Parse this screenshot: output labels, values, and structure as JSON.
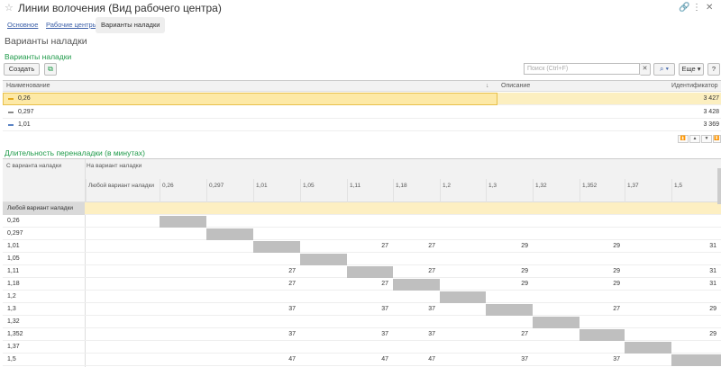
{
  "window": {
    "title": "Линии волочения (Вид рабочего центра)"
  },
  "tabs": [
    {
      "label": "Основное",
      "active": false
    },
    {
      "label": "Рабочие центры",
      "active": false
    },
    {
      "label": "Варианты наладки",
      "active": true
    }
  ],
  "subtitle": "Варианты наладки",
  "variants": {
    "section_title": "Варианты наладки",
    "create_label": "Создать",
    "search_placeholder": "Поиск (Ctrl+F)",
    "more_label": "Еще",
    "help_label": "?",
    "columns": {
      "name": "Наименование",
      "description": "Описание",
      "id": "Идентификатор"
    },
    "rows": [
      {
        "name": "0,26",
        "description": "",
        "id": "3 427",
        "selected": true,
        "marker_color": "#e3a91b"
      },
      {
        "name": "0,297",
        "description": "",
        "id": "3 428",
        "selected": false,
        "marker_color": "#8a8a8a"
      },
      {
        "name": "1,01",
        "description": "",
        "id": "3 369",
        "selected": false,
        "marker_color": "#5b83c4"
      }
    ]
  },
  "duration": {
    "section_title": "Длительность переналадки (в минутах)",
    "from_header": "С варианта наладки",
    "to_header": "На вариант наладки",
    "any_label": "Любой вариант наладки",
    "columns": [
      "Любой вариант наладки",
      "0,26",
      "0,297",
      "1,01",
      "1,05",
      "1,11",
      "1,18",
      "1,2",
      "1,3",
      "1,32",
      "1,352",
      "1,37",
      "1,5"
    ],
    "rows": [
      {
        "label": "Любой вариант наладки",
        "values": [
          "",
          "",
          "",
          "",
          "",
          "",
          "",
          "",
          "",
          "",
          "",
          ""
        ]
      },
      {
        "label": "0,26",
        "values": [
          "",
          "",
          "",
          "",
          "",
          "",
          "",
          "",
          "",
          "",
          "",
          ""
        ]
      },
      {
        "label": "0,297",
        "values": [
          "",
          "",
          "",
          "",
          "",
          "",
          "",
          "",
          "",
          "",
          "",
          ""
        ]
      },
      {
        "label": "1,01",
        "values": [
          "",
          "",
          "",
          "",
          "27",
          "27",
          "",
          "29",
          "",
          "29",
          "",
          "31"
        ]
      },
      {
        "label": "1,05",
        "values": [
          "",
          "",
          "",
          "",
          "",
          "",
          "",
          "",
          "",
          "",
          "",
          ""
        ]
      },
      {
        "label": "1,11",
        "values": [
          "",
          "",
          "27",
          "",
          "",
          "27",
          "",
          "29",
          "",
          "29",
          "",
          "31"
        ]
      },
      {
        "label": "1,18",
        "values": [
          "",
          "",
          "27",
          "",
          "27",
          "",
          "",
          "29",
          "",
          "29",
          "",
          "31"
        ]
      },
      {
        "label": "1,2",
        "values": [
          "",
          "",
          "",
          "",
          "",
          "",
          "",
          "",
          "",
          "",
          "",
          ""
        ]
      },
      {
        "label": "1,3",
        "values": [
          "",
          "",
          "37",
          "",
          "37",
          "37",
          "",
          "",
          "",
          "27",
          "",
          "29"
        ]
      },
      {
        "label": "1,32",
        "values": [
          "",
          "",
          "",
          "",
          "",
          "",
          "",
          "",
          "",
          "",
          "",
          ""
        ]
      },
      {
        "label": "1,352",
        "values": [
          "",
          "",
          "37",
          "",
          "37",
          "37",
          "",
          "27",
          "",
          "",
          "",
          "29"
        ]
      },
      {
        "label": "1,37",
        "values": [
          "",
          "",
          "",
          "",
          "",
          "",
          "",
          "",
          "",
          "",
          "",
          ""
        ]
      },
      {
        "label": "1,5",
        "values": [
          "",
          "",
          "47",
          "",
          "47",
          "47",
          "",
          "37",
          "",
          "37",
          "",
          ""
        ]
      }
    ]
  }
}
